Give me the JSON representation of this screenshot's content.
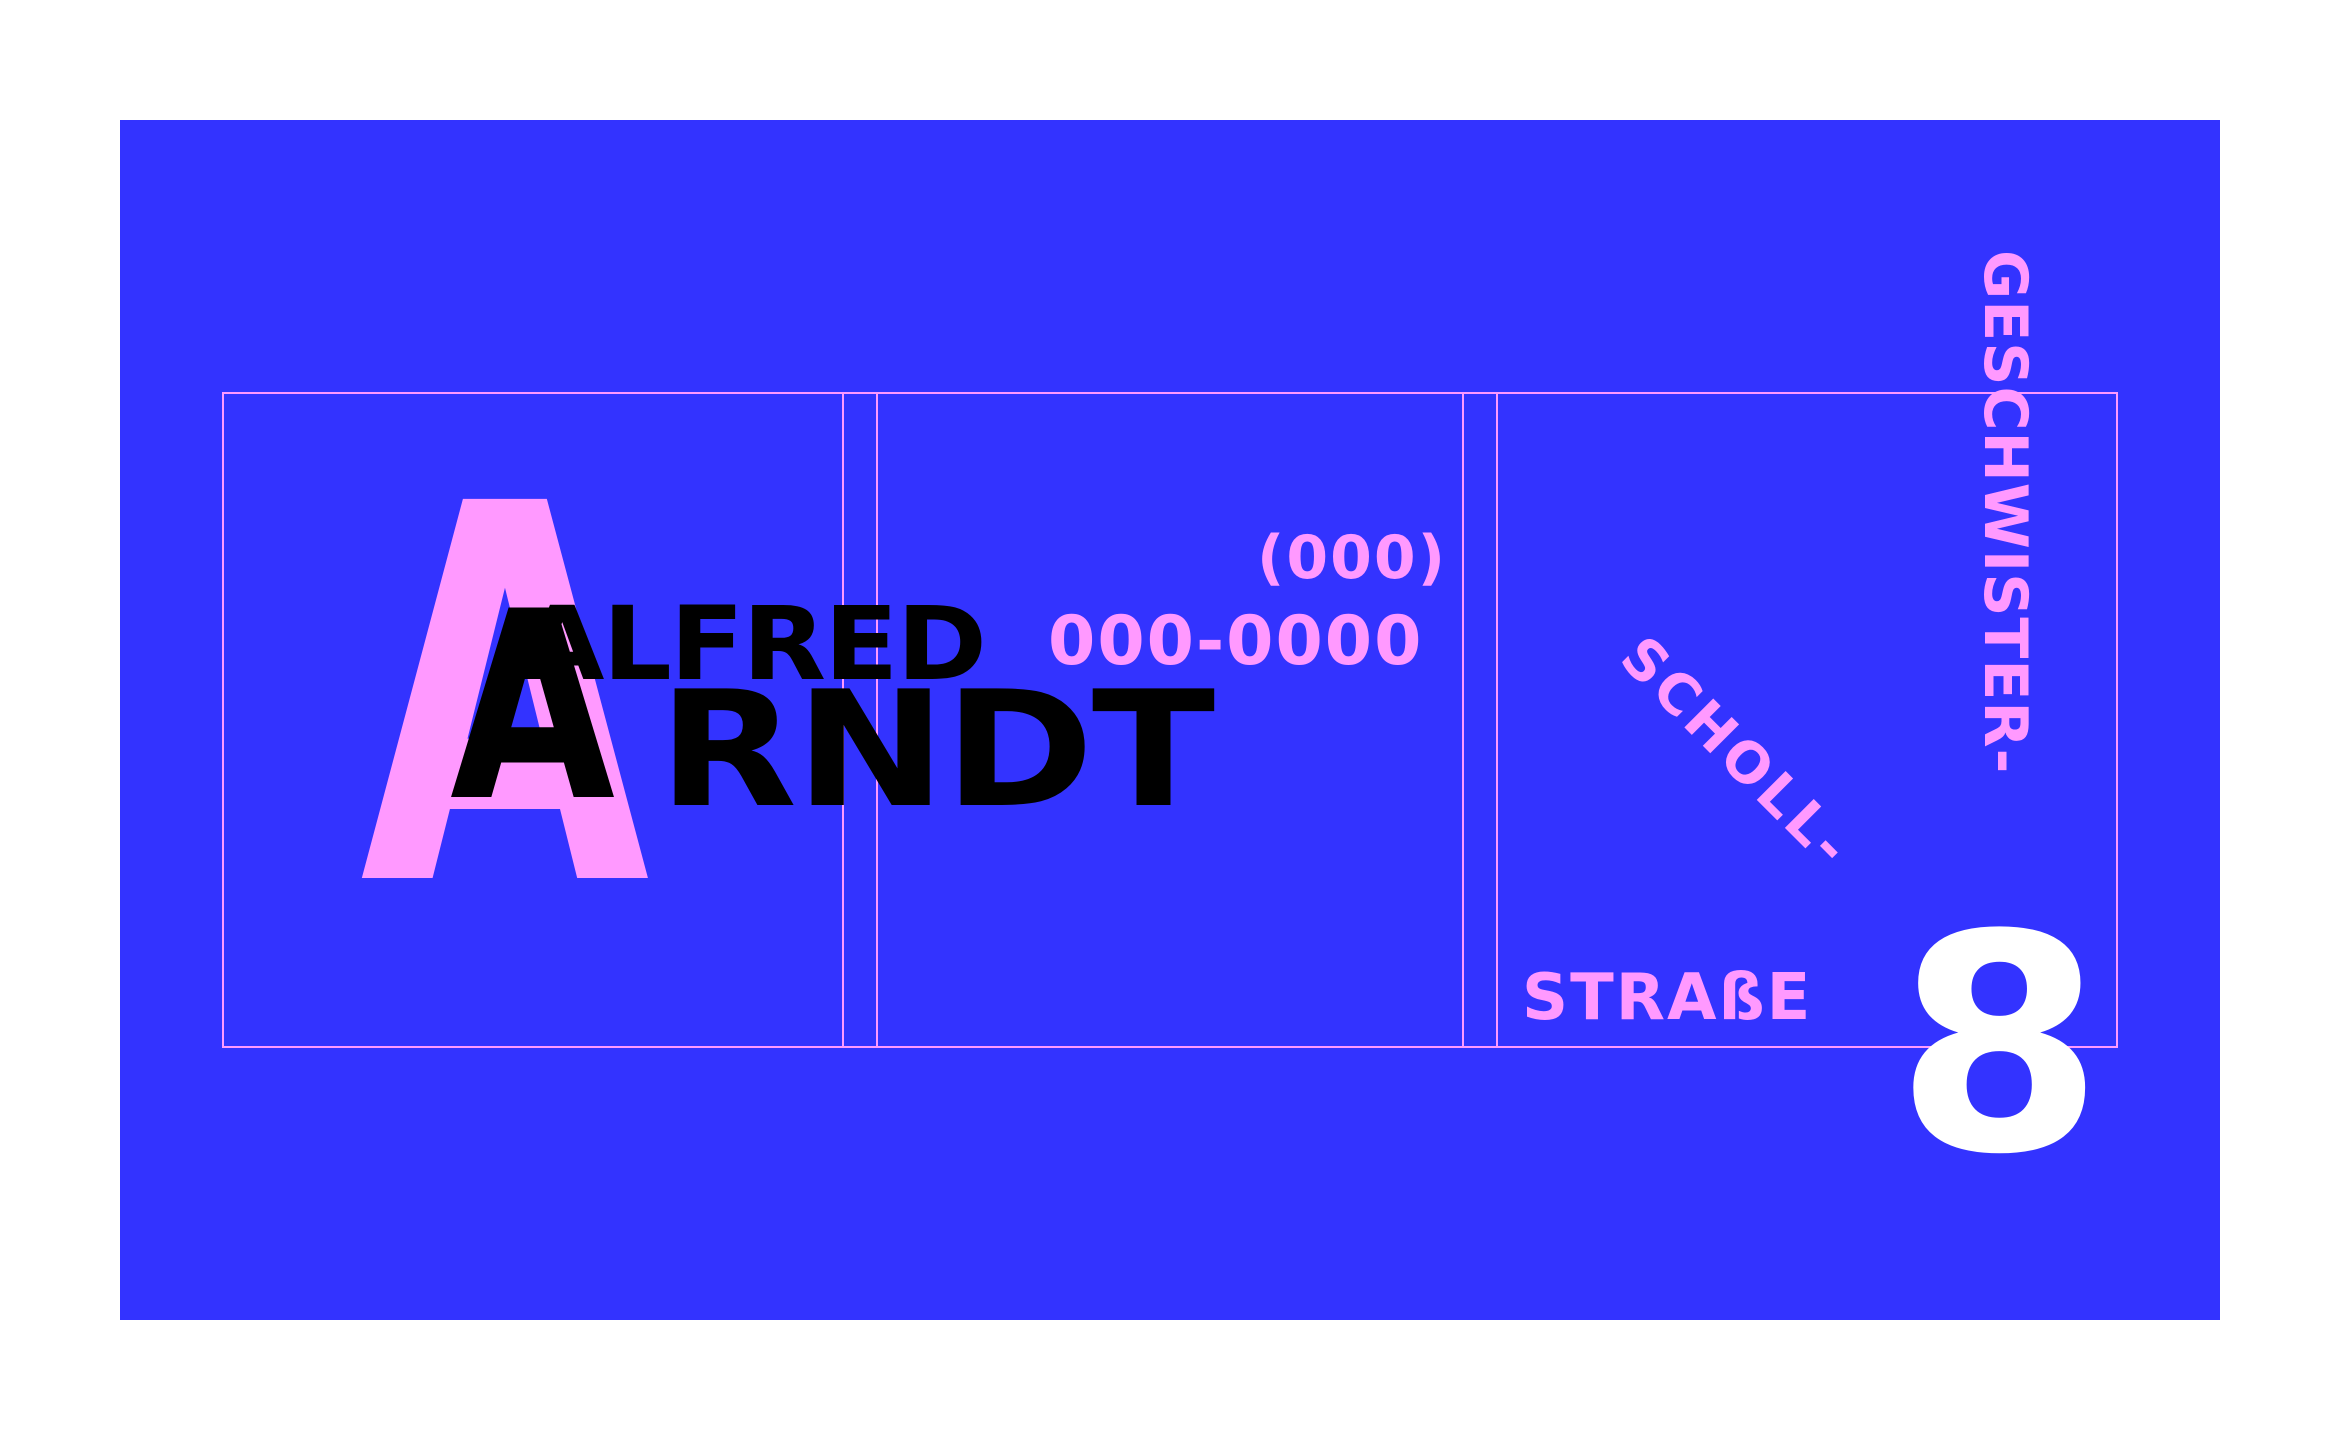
{
  "card": {
    "background": "#3333ff",
    "accent": "#ff99ff",
    "monogram_large": "A",
    "monogram_small": "A",
    "first_name": "ALFRED",
    "last_name": "RNDT",
    "phone_area": "(000)",
    "phone_number": "000-0000",
    "street_line1": "GESCHWISTER-",
    "street_line2": "SCHOLL-",
    "street_line3": "STRAßE",
    "house_number": "8"
  }
}
